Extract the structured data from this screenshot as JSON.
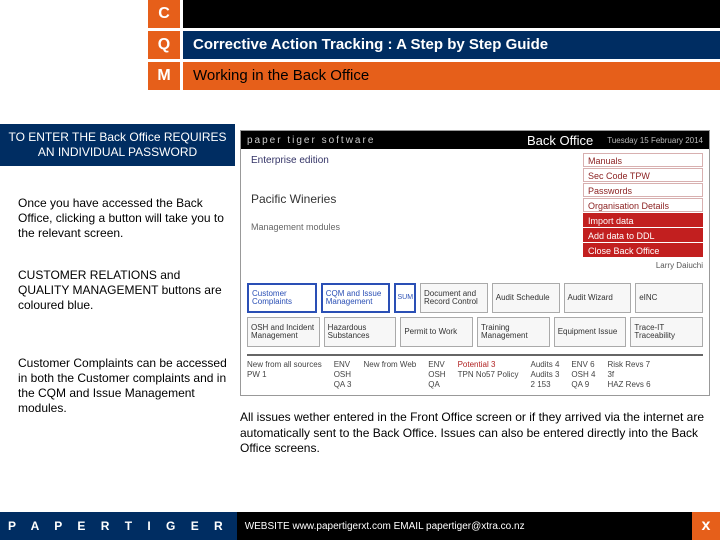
{
  "cqm": {
    "c": "C",
    "q": "Q",
    "m": "M"
  },
  "titles": {
    "line2": "Corrective Action Tracking : A Step by Step Guide",
    "line3": "Working in the Back Office"
  },
  "callout": "TO ENTER THE Back Office REQUIRES AN INDIVIDUAL PASSWORD",
  "para1": "Once you have accessed the Back Office, clicking a button will take you to the relevant screen.",
  "para2": "CUSTOMER RELATIONS and QUALITY MANAGEMENT buttons are coloured blue.",
  "para3": "Customer Complaints can be accessed in both the Customer complaints and in the CQM and Issue Management modules.",
  "screenshot": {
    "brand": "paper tiger software",
    "header": "Back Office",
    "date": "Tuesday 15 February 2014",
    "left": {
      "ee": "Enterprise edition",
      "company": "Pacific Wineries",
      "mm": "Management modules"
    },
    "menu": [
      "Manuals",
      "Sec Code   TPW",
      "Passwords",
      "Organisation Details",
      "Import data",
      "Add data to DDL",
      "Close Back Office"
    ],
    "user": "Larry Daiuchi",
    "row1": [
      "Customer Complaints",
      "CQM and Issue Management",
      "SUM",
      "Document and Record Control",
      "Audit Schedule",
      "Audit Wizard",
      "eINC"
    ],
    "row2": [
      "OSH and Incident Management",
      "Hazardous Substances",
      "Permit to Work",
      "Training Management",
      "Equipment Issue",
      "Trace-IT Traceability"
    ],
    "stats": {
      "c1": [
        "New from all sources",
        "PW  1"
      ],
      "c2": [
        "ENV",
        "OSH",
        "QA  3"
      ],
      "c3": [
        "New from Web"
      ],
      "c4": [
        "ENV",
        "OSH",
        "QA"
      ],
      "c5": [
        "Potential  3",
        "TPN No57 Policy"
      ],
      "c6": [
        "Audits  4",
        "Audits  3",
        "2  153"
      ],
      "c7": [
        "ENV  6",
        "OSH  4",
        "QA  9"
      ],
      "c8": [
        "Risk Revs  7",
        "3f",
        "HAZ Revs  6"
      ]
    }
  },
  "lower_note": "All issues wether entered in the Front Office screen or if they arrived via the internet are automatically sent to the Back Office. Issues can also be entered directly into the Back Office screens.",
  "footer": {
    "brand": "P A P E R   T I G E R",
    "contact": "WEBSITE  www.papertigerxt.com   EMAIL  papertiger@xtra.co.nz",
    "close": "x"
  }
}
